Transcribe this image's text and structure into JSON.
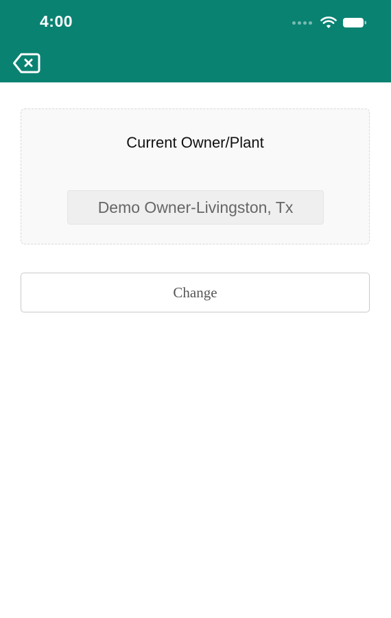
{
  "status_bar": {
    "time": "4:00",
    "wifi_icon": "wifi-icon",
    "battery_icon": "battery-icon"
  },
  "header": {
    "back_icon": "backspace-x-icon",
    "color": "#0a8272"
  },
  "owner_card": {
    "title": "Current Owner/Plant",
    "value": "Demo Owner-Livingston, Tx"
  },
  "actions": {
    "change_label": "Change"
  }
}
